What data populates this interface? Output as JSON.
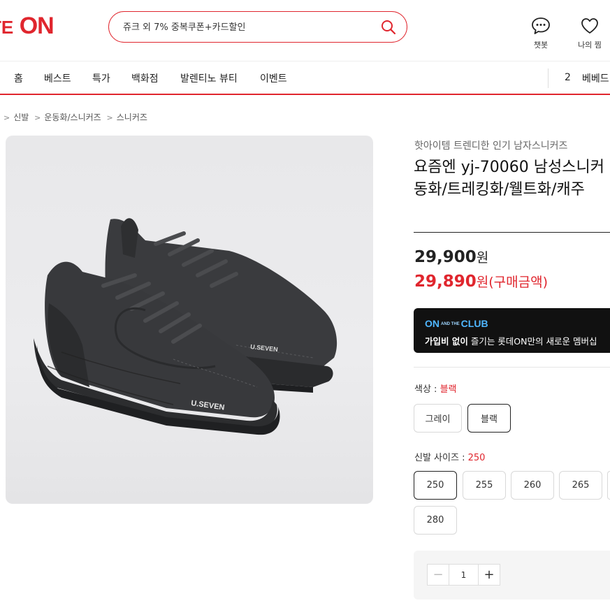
{
  "header": {
    "logo": "LOTTE ON",
    "search_placeholder": "쥬크 외 7% 중복쿠폰+카드할인",
    "chat_label": "챗봇",
    "wish_label": "나의 찜"
  },
  "nav": {
    "items": [
      "홈",
      "베스트",
      "특가",
      "백화점",
      "발렌티노 뷰티",
      "이벤트"
    ],
    "rank_number": "2",
    "rank_text": "베베드"
  },
  "breadcrumb": [
    "신발",
    "운동화/스니커즈",
    "스니커즈"
  ],
  "product": {
    "subtitle": "핫아이템 트렌디한 인기 남자스니커즈",
    "title_line1": "요즘엔 yj-70060 남성스니커",
    "title_line2": "동화/트레킹화/웰트화/캐주",
    "price_original": "29,900",
    "price_sale": "29,890",
    "unit": "원",
    "sale_suffix": "(구매금액)",
    "shoe_brand_text": "U.SEVEN"
  },
  "club": {
    "logo_on": "ON",
    "logo_and": "AND THE",
    "logo_club": "CLUB",
    "text_bold": "가입비 없이",
    "text_rest": " 즐기는 롯데ON만의 새로운 멤버십"
  },
  "options": {
    "color_label": "색상 : ",
    "color_selected": "블랙",
    "colors": [
      "그레이",
      "블랙"
    ],
    "size_label": "신발 사이즈 : ",
    "size_selected": "250",
    "sizes": [
      "250",
      "255",
      "260",
      "265",
      "280"
    ]
  },
  "quantity": {
    "value": "1",
    "minus": "−",
    "plus": "+"
  },
  "colors": {
    "brand_red": "#e0262e",
    "club_blue": "#4fb6ff"
  }
}
